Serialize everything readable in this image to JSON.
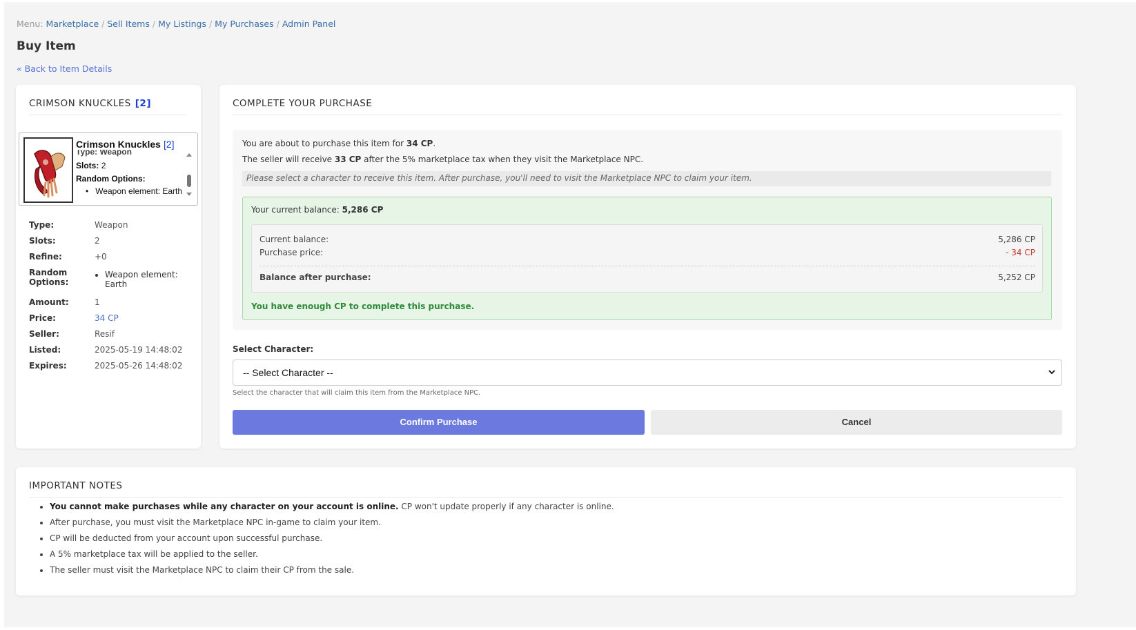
{
  "breadcrumb": {
    "prefix": "Menu:",
    "items": [
      "Marketplace",
      "Sell Items",
      "My Listings",
      "My Purchases",
      "Admin Panel"
    ]
  },
  "page_title": "Buy Item",
  "back_link": "« Back to Item Details",
  "item": {
    "header_name": "CRIMSON KNUCKLES",
    "header_slots": "[2]",
    "tooltip": {
      "name": "Crimson Knuckles",
      "slots": "[2]",
      "type_line": "Type: Weapon",
      "slots_label": "Slots:",
      "slots_value": "2",
      "random_options_label": "Random Options:",
      "option": "Weapon element: Earth"
    },
    "props": [
      {
        "key": "Type:",
        "value": "Weapon"
      },
      {
        "key": "Slots:",
        "value": "2"
      },
      {
        "key": "Refine:",
        "value": "+0"
      }
    ],
    "random_options_key": "Random Options:",
    "random_options": [
      "Weapon element: Earth"
    ],
    "props2": [
      {
        "key": "Amount:",
        "value": "1"
      },
      {
        "key": "Price:",
        "value": "34 CP"
      },
      {
        "key": "Seller:",
        "value": "Resif"
      },
      {
        "key": "Listed:",
        "value": "2025-05-19 14:48:02"
      },
      {
        "key": "Expires:",
        "value": "2025-05-26 14:48:02"
      }
    ]
  },
  "purchase": {
    "header": "COMPLETE YOUR PURCHASE",
    "line1_prefix": "You are about to purchase this item for ",
    "line1_amount": "34 CP",
    "line1_suffix": ".",
    "line2_prefix": "The seller will receive ",
    "line2_amount": "33 CP",
    "line2_suffix": " after the 5% marketplace tax when they visit the Marketplace NPC.",
    "note": "Please select a character to receive this item. After purchase, you'll need to visit the Marketplace NPC to claim your item.",
    "balance_title_prefix": "Your current balance: ",
    "balance_title_value": "5,286 CP",
    "current_balance_label": "Current balance:",
    "current_balance_value": "5,286 CP",
    "purchase_price_label": "Purchase price:",
    "purchase_price_value": "- 34 CP",
    "after_label": "Balance after purchase:",
    "after_value": "5,252 CP",
    "enough_text": "You have enough CP to complete this purchase.",
    "select_label": "Select Character:",
    "select_value": "-- Select Character --",
    "select_help": "Select the character that will claim this item from the Marketplace NPC.",
    "confirm_label": "Confirm Purchase",
    "cancel_label": "Cancel"
  },
  "notes": {
    "header": "IMPORTANT NOTES",
    "first_bold": "You cannot make purchases while any character on your account is online.",
    "first_rest": " CP won't update properly if any character is online.",
    "items": [
      "After purchase, you must visit the Marketplace NPC in-game to claim your item.",
      "CP will be deducted from your account upon successful purchase.",
      "A 5% marketplace tax will be applied to the seller.",
      "The seller must visit the Marketplace NPC to claim their CP from the sale."
    ]
  },
  "colors": {
    "link": "#3a6ea8",
    "confirm_button": "#6c7ae0",
    "success_green": "#2e8a3a",
    "negative_red": "#c0392b",
    "slots_blue": "#1a3fd6"
  }
}
